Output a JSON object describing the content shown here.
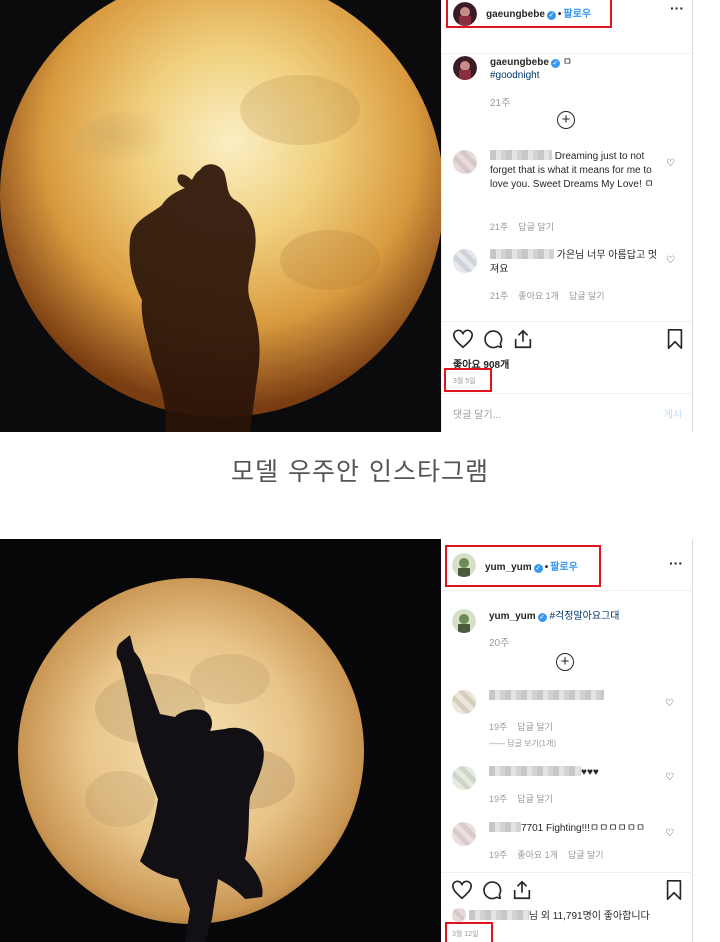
{
  "post1": {
    "username": "gaeungbebe",
    "follow_label": "팔로우",
    "dot": "•",
    "more": "···",
    "caption": {
      "username": "gaeungbebe",
      "emoji": "ㅁ",
      "hashtag": "#goodnight"
    },
    "caption_age": "21주",
    "comments": [
      {
        "text": "Dreaming just to not forget that is what it means for me to love you. Sweet Dreams My Love! ㅁ",
        "age": "21주",
        "reply": "답글 달기"
      },
      {
        "text": "가은님 너무 아름답고 멋져요",
        "age": "21주",
        "likes": "좋아요 1개",
        "reply": "답글 달기"
      }
    ],
    "likes": "좋아요 908개",
    "date": "3월 5일",
    "comment_placeholder": "댓글 달기...",
    "post_button": "게시"
  },
  "middle_caption": "모델 우주안 인스타그램",
  "post2": {
    "username": "yum_yum",
    "follow_label": "팔로우",
    "dot": "•",
    "more": "···",
    "caption": {
      "username": "yum_yum",
      "hashtag": "#걱정말아요그대"
    },
    "caption_age": "20주",
    "comments": [
      {
        "text": "",
        "age": "19주",
        "reply": "답글 달기",
        "view_replies": "답글 보기(1개)"
      },
      {
        "text": "♥♥♥",
        "age": "19주",
        "reply": "답글 달기"
      },
      {
        "text": "7701 Fighting!!!ㅁㅁㅁㅁㅁㅁ",
        "age": "19주",
        "likes": "좋아요 1개",
        "reply": "답글 달기"
      }
    ],
    "likes_text": "님 외 11,791명이 좋아합니다",
    "date": "3월 12일"
  },
  "icons": [
    "heart-icon",
    "comment-icon",
    "share-icon",
    "bookmark-icon",
    "add-comment-icon",
    "verified-badge-icon"
  ],
  "colors": {
    "follow": "#3897f0",
    "highlight_box": "#e0141c",
    "moon_warm": "#e8b45a",
    "night": "#0a0a0d"
  }
}
